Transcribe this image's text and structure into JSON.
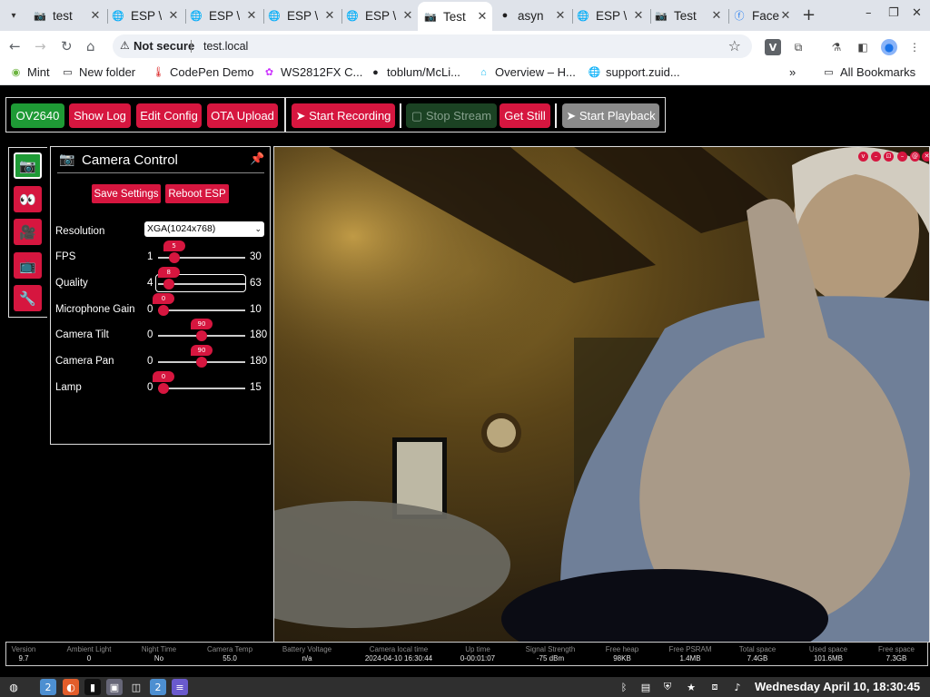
{
  "browser": {
    "tabs": [
      {
        "title": "test",
        "icon": "camera-icon",
        "active": false
      },
      {
        "title": "ESP \\",
        "icon": "globe-icon",
        "active": false
      },
      {
        "title": "ESP \\",
        "icon": "globe-icon",
        "active": false
      },
      {
        "title": "ESP \\",
        "icon": "globe-icon",
        "active": false
      },
      {
        "title": "ESP \\",
        "icon": "globe-icon",
        "active": false
      },
      {
        "title": "Test",
        "icon": "camera-icon",
        "active": true
      },
      {
        "title": "asyn",
        "icon": "github-icon",
        "active": false
      },
      {
        "title": "ESP \\",
        "icon": "globe-icon",
        "active": false
      },
      {
        "title": "Test",
        "icon": "camera-icon",
        "active": false
      },
      {
        "title": "Face",
        "icon": "facebook-icon",
        "active": false
      }
    ],
    "new_tab": "+",
    "window_controls": {
      "minimize": "–",
      "restore": "❐",
      "close": "✕"
    },
    "address": {
      "security_label": "Not secure",
      "url": "test.local"
    },
    "bookmarks": [
      {
        "label": "Mint",
        "icon": "mint-icon"
      },
      {
        "label": "New folder",
        "icon": "folder-icon"
      },
      {
        "label": "CodePen Demo",
        "icon": "thermometer-icon"
      },
      {
        "label": "WS2812FX C...",
        "icon": "color-dots-icon"
      },
      {
        "label": "toblum/McLi...",
        "icon": "github-icon"
      },
      {
        "label": "Overview – H...",
        "icon": "home-assistant-icon"
      },
      {
        "label": "support.zuid...",
        "icon": "globe-icon"
      }
    ],
    "bookmarks_more": "»",
    "all_bookmarks": "All Bookmarks"
  },
  "toolbar": {
    "model": "OV2640",
    "show_log": "Show Log",
    "edit_config": "Edit Config",
    "ota_upload": "OTA Upload",
    "start_recording": "➤ Start Recording",
    "stop_stream": "▢ Stop Stream",
    "get_still": "Get Still",
    "start_playback": "➤ Start Playback"
  },
  "sidebar_tools": [
    {
      "name": "camera-tool",
      "glyph": "📷",
      "selected": true
    },
    {
      "name": "eyes-tool",
      "glyph": "👀",
      "selected": false
    },
    {
      "name": "video-camera-tool",
      "glyph": "🎥",
      "selected": false
    },
    {
      "name": "tv-tool",
      "glyph": "📺",
      "selected": false
    },
    {
      "name": "wrench-tool",
      "glyph": "🔧",
      "selected": false
    }
  ],
  "panel": {
    "title": "Camera Control",
    "save_settings": "Save Settings",
    "reboot_esp": "Reboot ESP",
    "resolution_label": "Resolution",
    "resolution_value": "XGA(1024x768)",
    "sliders": [
      {
        "key": "fps",
        "label": "FPS",
        "min": 1,
        "max": 30,
        "value": 5
      },
      {
        "key": "quality",
        "label": "Quality",
        "min": 4,
        "max": 63,
        "value": 8,
        "focused": true
      },
      {
        "key": "mic-gain",
        "label": "Microphone Gain",
        "min": 0,
        "max": 10,
        "value": 0
      },
      {
        "key": "camera-tilt",
        "label": "Camera Tilt",
        "min": 0,
        "max": 180,
        "value": 90
      },
      {
        "key": "camera-pan",
        "label": "Camera Pan",
        "min": 0,
        "max": 180,
        "value": 90
      },
      {
        "key": "lamp",
        "label": "Lamp",
        "min": 0,
        "max": 15,
        "value": 0
      }
    ]
  },
  "video_controls": [
    "v",
    "–",
    "⊡",
    "–",
    "@",
    "✕"
  ],
  "status": [
    {
      "label": "Version",
      "value": "9.7"
    },
    {
      "label": "Ambient Light",
      "value": "0"
    },
    {
      "label": "Night Time",
      "value": "No"
    },
    {
      "label": "Camera Temp",
      "value": "55.0"
    },
    {
      "label": "Battery Voltage",
      "value": "n/a"
    },
    {
      "label": "Camera local time",
      "value": "2024-04-10 16:30:44"
    },
    {
      "label": "Up time",
      "value": "0-00:01:07"
    },
    {
      "label": "Signal Strength",
      "value": "-75 dBm"
    },
    {
      "label": "Free heap",
      "value": "98KB"
    },
    {
      "label": "Free PSRAM",
      "value": "1.4MB"
    },
    {
      "label": "Total space",
      "value": "7.4GB"
    },
    {
      "label": "Used space",
      "value": "101.6MB"
    },
    {
      "label": "Free space",
      "value": "7.3GB"
    }
  ],
  "taskbar": {
    "clock": "Wednesday April 10, 18:30:45"
  },
  "colors": {
    "accent_red": "#d6163f",
    "accent_green": "#1e9a35",
    "dark_green": "#1b4223",
    "grey_button": "#8a8a8a"
  }
}
